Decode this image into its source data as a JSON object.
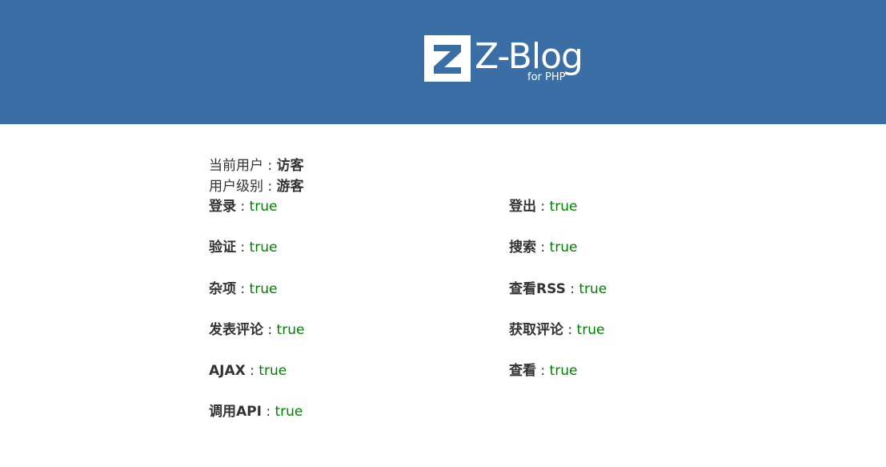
{
  "header": {
    "logo": {
      "mark_letter": "Z",
      "title": "Z-Blog",
      "subtitle": "for PHP"
    },
    "background_color": "#3a6ea5"
  },
  "user": {
    "current_user_label": "当前用户",
    "current_user_value": "访客",
    "user_level_label": "用户级别",
    "user_level_value": "游客"
  },
  "separator": " : ",
  "permissions": [
    {
      "label": "登录",
      "value": "true"
    },
    {
      "label": "登出",
      "value": "true"
    },
    {
      "label": "验证",
      "value": "true"
    },
    {
      "label": "搜索",
      "value": "true"
    },
    {
      "label": "杂项",
      "value": "true"
    },
    {
      "label": "查看RSS",
      "value": "true"
    },
    {
      "label": "发表评论",
      "value": "true"
    },
    {
      "label": "获取评论",
      "value": "true"
    },
    {
      "label": "AJAX",
      "value": "true"
    },
    {
      "label": "查看",
      "value": "true"
    },
    {
      "label": "调用API",
      "value": "true"
    }
  ],
  "colors": {
    "true_value": "#008000",
    "text": "#333333"
  }
}
